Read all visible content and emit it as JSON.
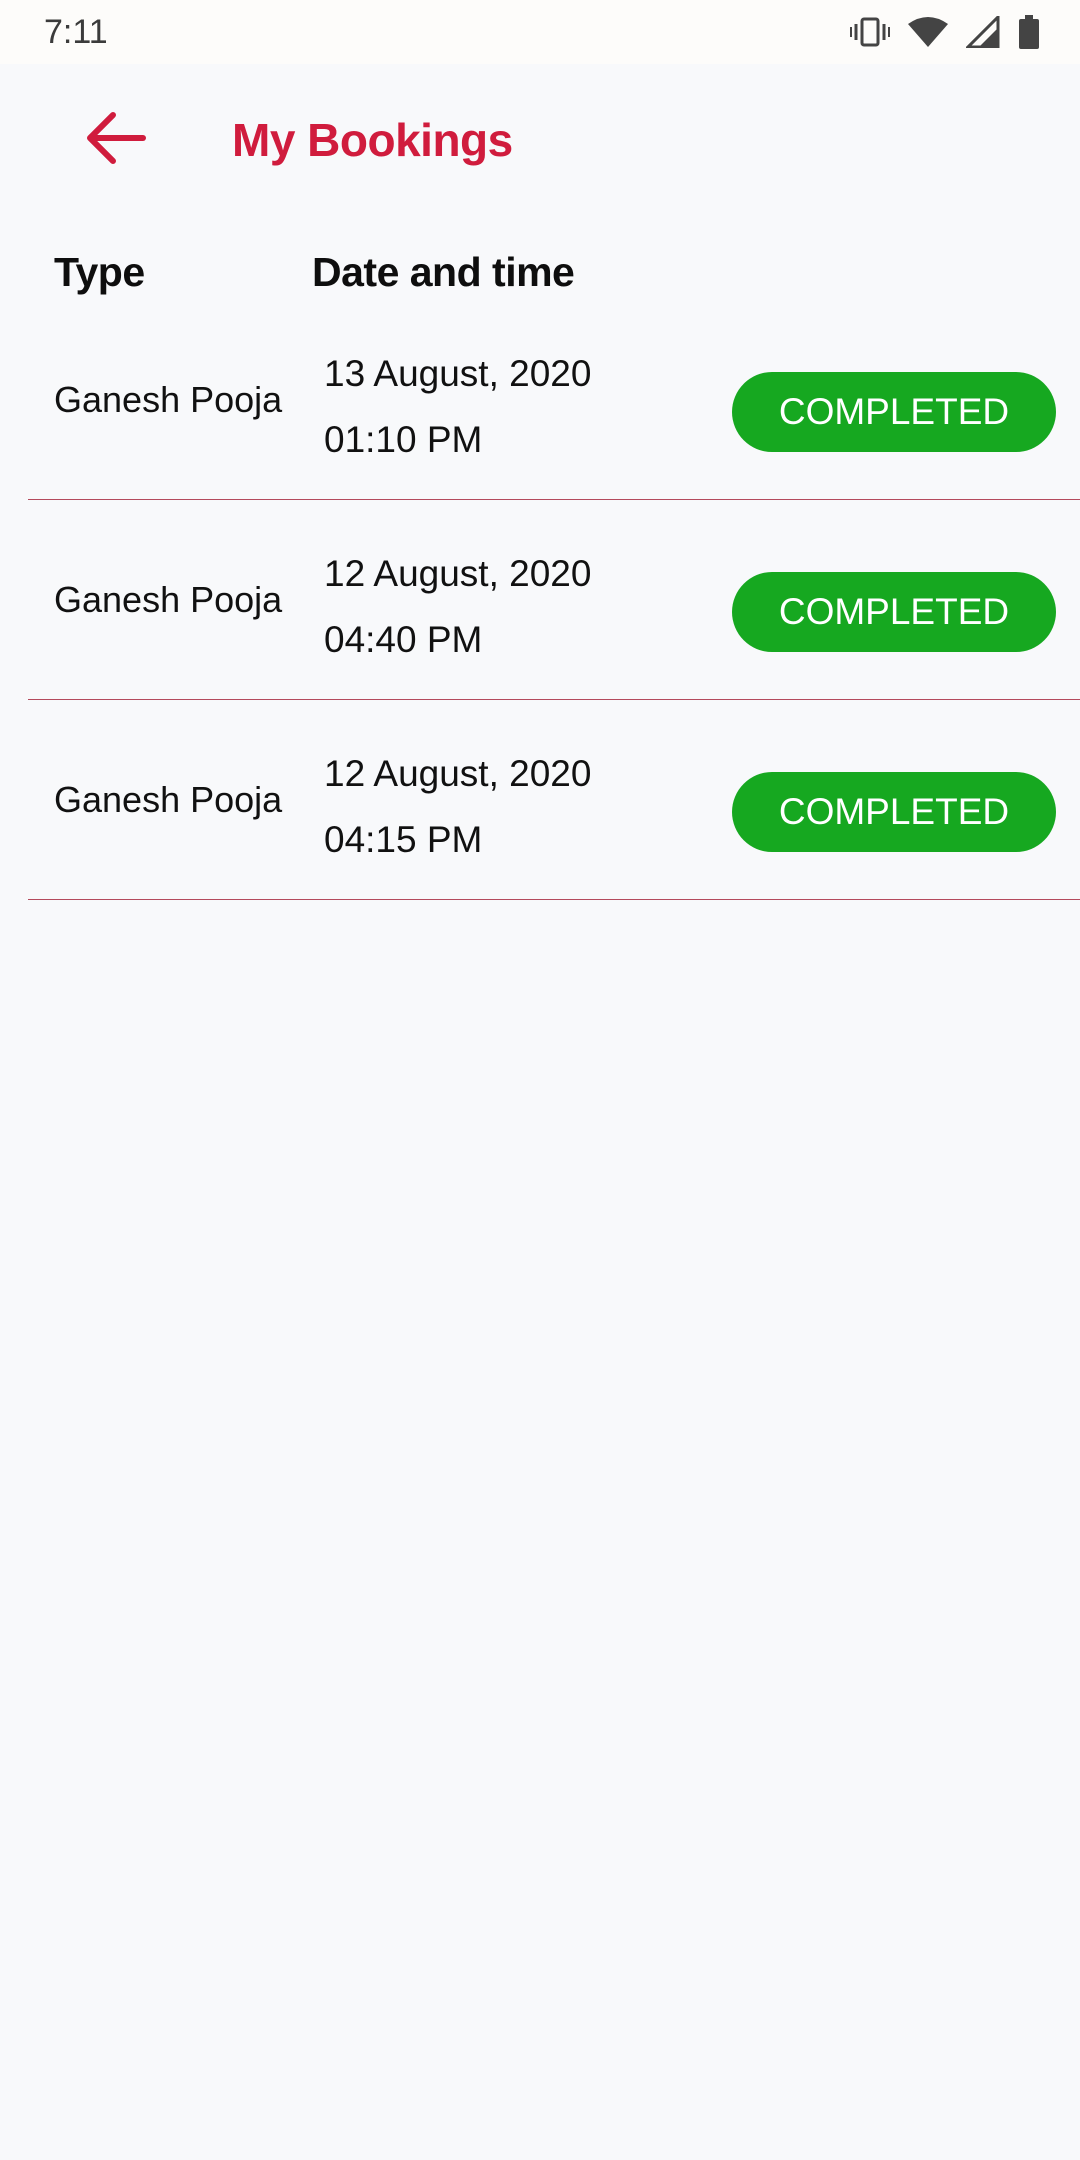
{
  "status_bar": {
    "time": "7:11",
    "icons": [
      "vibrate-icon",
      "wifi-icon",
      "cell-signal-icon",
      "battery-icon"
    ]
  },
  "header": {
    "title": "My Bookings",
    "back_icon": "arrow-back-icon"
  },
  "table": {
    "columns": [
      "Type",
      "Date and time"
    ],
    "rows": [
      {
        "type": "Ganesh Pooja",
        "date": "13 August, 2020",
        "time": "01:10 PM",
        "status": "COMPLETED"
      },
      {
        "type": "Ganesh Pooja",
        "date": "12 August, 2020",
        "time": "04:40 PM",
        "status": "COMPLETED"
      },
      {
        "type": "Ganesh Pooja",
        "date": "12 August, 2020",
        "time": "04:15 PM",
        "status": "COMPLETED"
      }
    ]
  },
  "colors": {
    "accent": "#d01c3d",
    "status_completed": "#16a820",
    "divider": "#b44a5c",
    "background": "#f8f9fb"
  }
}
